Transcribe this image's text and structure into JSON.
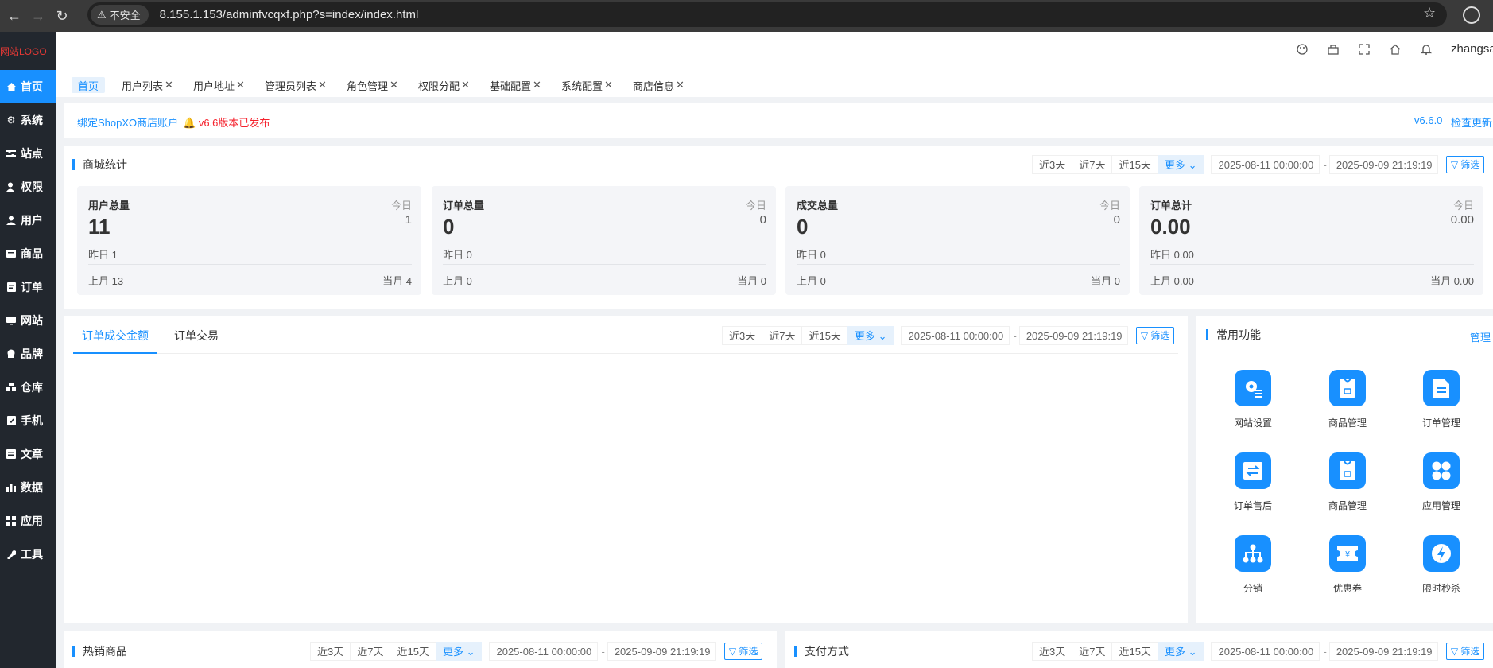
{
  "browser": {
    "security_label": "不安全",
    "url": "8.155.1.153/adminfvcqxf.php?s=index/index.html"
  },
  "sidebar": {
    "logo": "网站LOGO",
    "items": [
      {
        "label": "首页",
        "icon": "home-icon"
      },
      {
        "label": "系统",
        "icon": "gear-icon"
      },
      {
        "label": "站点",
        "icon": "sliders-icon"
      },
      {
        "label": "权限",
        "icon": "user-shield-icon"
      },
      {
        "label": "用户",
        "icon": "user-icon"
      },
      {
        "label": "商品",
        "icon": "goods-icon"
      },
      {
        "label": "订单",
        "icon": "order-icon"
      },
      {
        "label": "网站",
        "icon": "monitor-icon"
      },
      {
        "label": "品牌",
        "icon": "brand-icon"
      },
      {
        "label": "仓库",
        "icon": "warehouse-icon"
      },
      {
        "label": "手机",
        "icon": "phone-icon"
      },
      {
        "label": "文章",
        "icon": "article-icon"
      },
      {
        "label": "数据",
        "icon": "chart-icon"
      },
      {
        "label": "应用",
        "icon": "apps-icon"
      },
      {
        "label": "工具",
        "icon": "wrench-icon"
      }
    ]
  },
  "header": {
    "user": "zhangsan",
    "icons": [
      "palette-icon",
      "clear-cache-icon",
      "fullscreen-icon",
      "home-icon",
      "bell-icon"
    ]
  },
  "tabs": [
    {
      "label": "首页"
    },
    {
      "label": "用户列表"
    },
    {
      "label": "用户地址"
    },
    {
      "label": "管理员列表"
    },
    {
      "label": "角色管理"
    },
    {
      "label": "权限分配"
    },
    {
      "label": "基础配置"
    },
    {
      "label": "系统配置"
    },
    {
      "label": "商店信息"
    }
  ],
  "notice": {
    "bind": "绑定ShopXO商店账户",
    "release": "v6.6版本已发布",
    "version": "v6.6.0",
    "check_update": "检查更新"
  },
  "filters": {
    "d3": "近3天",
    "d7": "近7天",
    "d15": "近15天",
    "more": "更多",
    "start": "2025-08-11 00:00:00",
    "end": "2025-09-09 21:19:19",
    "screen": "筛选",
    "dash": "-"
  },
  "stats": {
    "title": "商城统计",
    "today_label": "今日",
    "cards": [
      {
        "label": "用户总量",
        "value": "11",
        "today": "1",
        "yesterday": "昨日   1",
        "last_month": "上月    13",
        "this_month": "当月    4"
      },
      {
        "label": "订单总量",
        "value": "0",
        "today": "0",
        "yesterday": "昨日 0",
        "last_month": "上月    0",
        "this_month": "当月    0"
      },
      {
        "label": "成交总量",
        "value": "0",
        "today": "0",
        "yesterday": "昨日 0",
        "last_month": "上月    0",
        "this_month": "当月    0"
      },
      {
        "label": "订单总计",
        "value": "0.00",
        "today": "0.00",
        "yesterday": "昨日 0.00",
        "last_month": "上月    0.00",
        "this_month": "当月    0.00"
      }
    ]
  },
  "order_chart": {
    "tabs": [
      "订单成交金额",
      "订单交易"
    ]
  },
  "quick_functions": {
    "title": "常用功能",
    "manage": "管理",
    "items": [
      {
        "label": "网站设置",
        "icon": "site-settings-icon"
      },
      {
        "label": "商品管理",
        "icon": "goods-bag-icon"
      },
      {
        "label": "订单管理",
        "icon": "order-doc-icon"
      },
      {
        "label": "订单售后",
        "icon": "exchange-icon"
      },
      {
        "label": "商品管理",
        "icon": "goods-bag-icon"
      },
      {
        "label": "应用管理",
        "icon": "apps-grid-icon"
      },
      {
        "label": "分销",
        "icon": "distribution-icon"
      },
      {
        "label": "优惠券",
        "icon": "coupon-icon"
      },
      {
        "label": "限时秒杀",
        "icon": "flash-sale-icon"
      }
    ]
  },
  "hot_goods": {
    "title": "热销商品"
  },
  "payment": {
    "title": "支付方式"
  },
  "colors": {
    "accent": "#1890ff",
    "sidebar_bg": "#22272e",
    "danger": "#f5222d"
  }
}
